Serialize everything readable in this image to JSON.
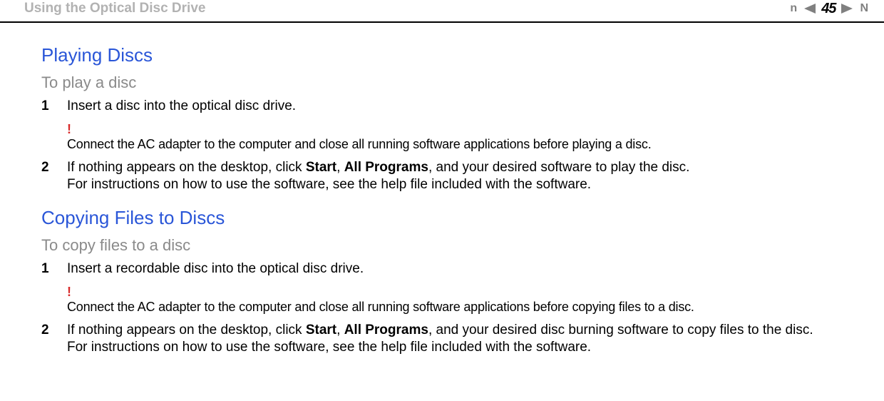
{
  "header": {
    "breadcrumb": "Using the Optical Disc Drive",
    "page_number": "45",
    "prev_letter": "n",
    "next_letter": "N"
  },
  "section1": {
    "title": "Playing Discs",
    "subtitle": "To play a disc",
    "step1_num": "1",
    "step1_text": "Insert a disc into the optical disc drive.",
    "bang": "!",
    "note": "Connect the AC adapter to the computer and close all running software applications before playing a disc.",
    "step2_num": "2",
    "step2_pre": "If nothing appears on the desktop, click ",
    "step2_b1": "Start",
    "step2_mid1": ", ",
    "step2_b2": "All Programs",
    "step2_post": ", and your desired software to play the disc.",
    "step2_line2": "For instructions on how to use the software, see the help file included with the software."
  },
  "section2": {
    "title": "Copying Files to Discs",
    "subtitle": "To copy files to a disc",
    "step1_num": "1",
    "step1_text": "Insert a recordable disc into the optical disc drive.",
    "bang": "!",
    "note": "Connect the AC adapter to the computer and close all running software applications before copying files to a disc.",
    "step2_num": "2",
    "step2_pre": "If nothing appears on the desktop, click ",
    "step2_b1": "Start",
    "step2_mid1": ", ",
    "step2_b2": "All Programs",
    "step2_post": ", and your desired disc burning software to copy files to the disc.",
    "step2_line2": "For instructions on how to use the software, see the help file included with the software."
  }
}
